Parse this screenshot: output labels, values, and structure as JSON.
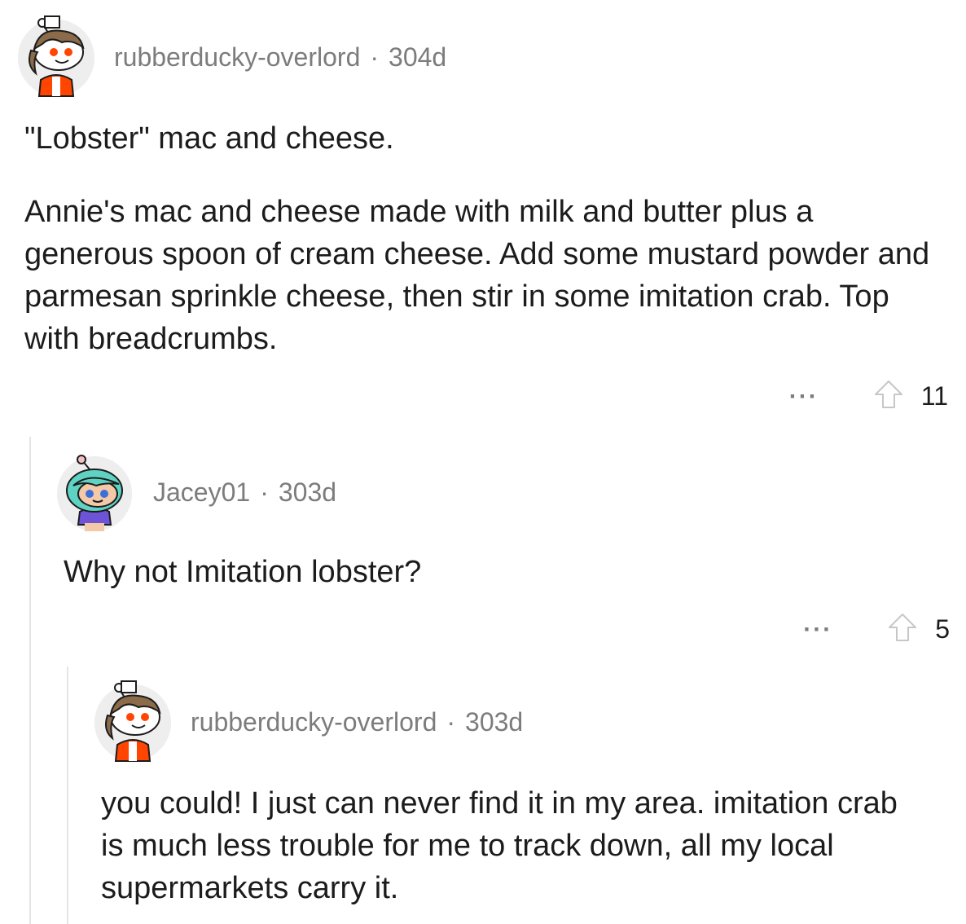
{
  "comments": [
    {
      "username": "rubberducky-overlord",
      "separator": "·",
      "age": "304d",
      "paragraphs": [
        "\"Lobster\" mac and cheese.",
        "Annie's mac and cheese made with milk and butter plus a generous spoon of cream cheese. Add some mustard powder and parmesan sprinkle cheese, then stir in some imitation crab. Top with breadcrumbs."
      ],
      "more_label": "···",
      "upvote_icon": "upvote-arrow-icon",
      "votes": "11"
    },
    {
      "username": "Jacey01",
      "separator": "·",
      "age": "303d",
      "paragraphs": [
        "Why not Imitation lobster?"
      ],
      "more_label": "···",
      "upvote_icon": "upvote-arrow-icon",
      "votes": "5"
    },
    {
      "username": "rubberducky-overlord",
      "separator": "·",
      "age": "303d",
      "paragraphs": [
        "you could! I just can never find it in my area. imitation crab is much less trouble for me to track down, all my local supermarkets carry it."
      ]
    }
  ],
  "colors": {
    "meta_text": "#7c7c7c",
    "body_text": "#1c1c1c",
    "thread_line": "#e5e5e5",
    "avatar_orange": "#ff4500",
    "avatar_teal": "#5fd3c3"
  }
}
